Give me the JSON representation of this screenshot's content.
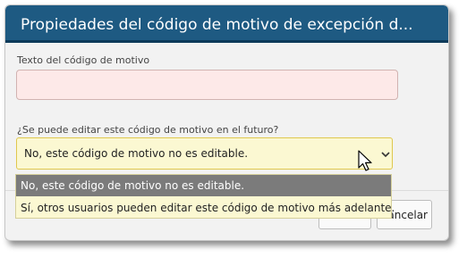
{
  "dialog": {
    "title": "Propiedades del código de motivo de excepción d..."
  },
  "form": {
    "text_label": "Texto del código de motivo",
    "text_value": "",
    "editable_label": "¿Se puede editar este código de motivo en el futuro?",
    "editable_value": "No, este código de motivo no es editable.",
    "editable_options": [
      "No, este código de motivo no es editable.",
      "Sí, otros usuarios pueden editar este código de motivo más adelante."
    ]
  },
  "buttons": {
    "cancel_label": "Cancelar"
  },
  "colors": {
    "titlebar": "#1e5a82",
    "input_invalid": "#fde9e8",
    "select_focus": "#fbf8d2",
    "option_selected": "#7b7b7b"
  },
  "icons": {
    "select_arrow": "chevron-down-icon",
    "pointer": "mouse-cursor-icon"
  }
}
